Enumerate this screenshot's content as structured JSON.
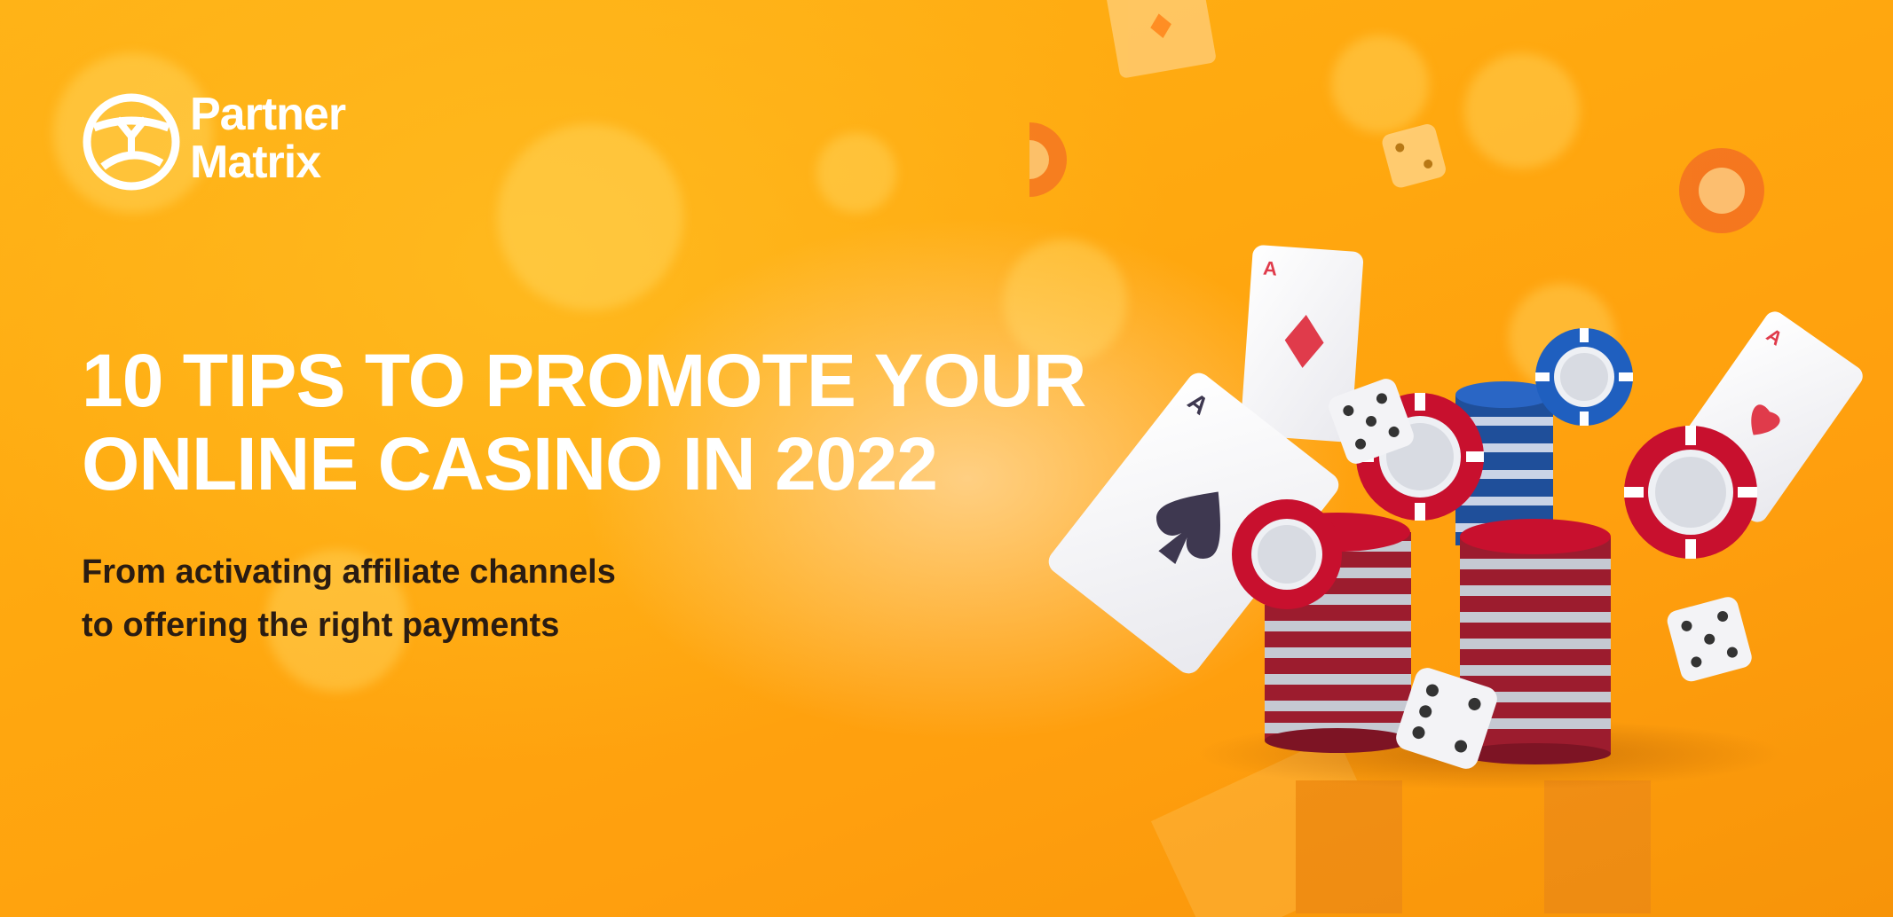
{
  "brand": {
    "name_line1": "Partner",
    "name_line2": "Matrix",
    "logo_icon": "partnermatrix-logo-icon"
  },
  "headline": {
    "line1": "10 TIPS TO PROMOTE YOUR",
    "line2": "ONLINE CASINO IN 2022"
  },
  "subline": {
    "line1": "From activating affiliate channels",
    "line2": "to offering the right payments"
  },
  "card_rank": "A",
  "colors": {
    "background": "#ffa80f",
    "headline": "#ffffff",
    "subline": "#2a1c12",
    "chip_red": "#c8102e",
    "chip_blue": "#1f5fbf"
  }
}
